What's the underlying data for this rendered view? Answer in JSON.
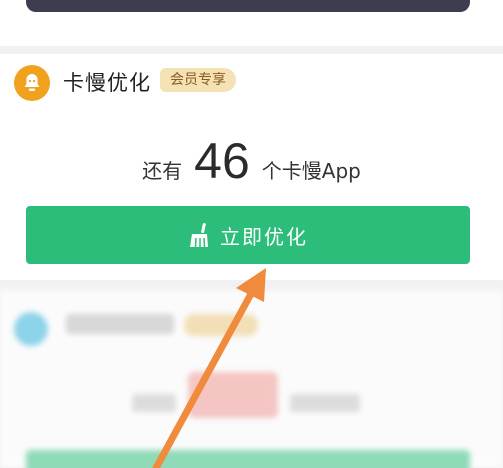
{
  "feature": {
    "title": "卡慢优化",
    "badge": "会员专享",
    "count_prefix": "还有",
    "count_value": "46",
    "count_suffix": "个卡慢App",
    "button_label": "立即优化",
    "icon": "bell-icon",
    "button_icon": "broom-icon"
  },
  "colors": {
    "icon_bg": "#f0a21f",
    "button": "#2dbd7a",
    "badge_bg": "#f4e2b4",
    "badge_text": "#8a5a20",
    "arrow": "#f08a3c"
  },
  "overlay": {
    "arrow": "arrow-annotation"
  }
}
